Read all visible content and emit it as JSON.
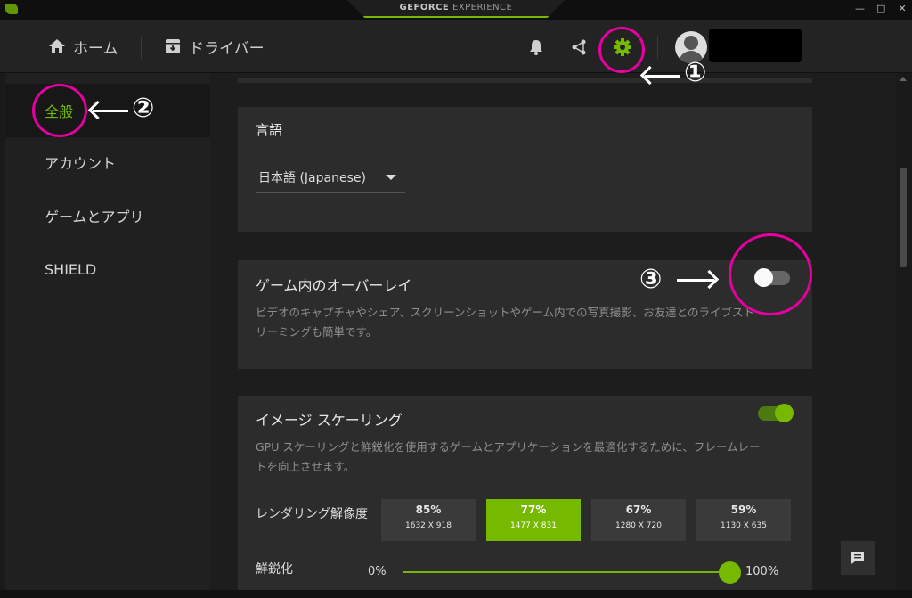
{
  "window": {
    "brand_strong": "GEFORCE",
    "brand_light": "EXPERIENCE",
    "controls": [
      "—",
      "□",
      "✕"
    ]
  },
  "nav": {
    "home_label": "ホーム",
    "drivers_label": "ドライバー"
  },
  "sidebar": {
    "items": [
      {
        "label": "全般",
        "active": true
      },
      {
        "label": "アカウント",
        "active": false
      },
      {
        "label": "ゲームとアプリ",
        "active": false
      },
      {
        "label": "SHIELD",
        "active": false
      }
    ]
  },
  "language": {
    "title": "言語",
    "selected": "日本語 (Japanese)"
  },
  "overlay": {
    "title": "ゲーム内のオーバーレイ",
    "description": "ビデオのキャプチャやシェア、スクリーンショットやゲーム内での写真撮影、お友達とのライブストリーミングも簡単です。",
    "enabled": false
  },
  "image_scaling": {
    "title": "イメージ スケーリング",
    "description": "GPU スケーリングと鮮鋭化を使用するゲームとアプリケーションを最適化するために、フレームレートを向上させます。",
    "enabled": true,
    "render_label": "レンダリング解像度",
    "options": [
      {
        "pct": "85%",
        "res": "1632 X 918"
      },
      {
        "pct": "77%",
        "res": "1477 X 831"
      },
      {
        "pct": "67%",
        "res": "1280 X 720"
      },
      {
        "pct": "59%",
        "res": "1130 X 635"
      }
    ],
    "selected_pct": "77%",
    "sharpen_label": "鮮鋭化",
    "sharpen_min": "0%",
    "sharpen_max": "100%",
    "sharpen_value": 1.0
  },
  "annotations": [
    "①",
    "②",
    "③"
  ],
  "colors": {
    "accent": "#76b900",
    "highlight_ring": "#e5009f"
  }
}
